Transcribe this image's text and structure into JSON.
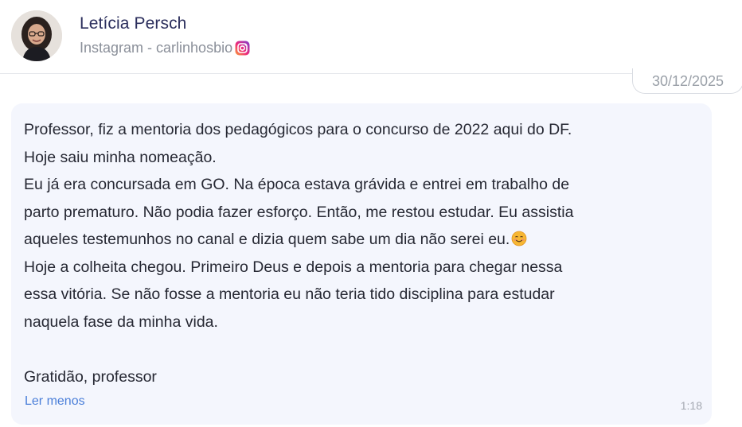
{
  "author": {
    "name": "Letícia Persch",
    "source": "Instagram - carlinhosbio",
    "avatar_icon": "profile-photo",
    "source_icon": "instagram-icon"
  },
  "date": "30/12/2025",
  "message": {
    "lines": [
      "Professor, fiz a mentoria dos pedagógicos para o concurso de 2022 aqui do DF.",
      "Hoje saiu minha nomeação.",
      "Eu já era concursada em GO. Na época estava grávida e entrei em trabalho de",
      "parto prematuro. Não podia fazer esforço. Então, me restou estudar. Eu assistia",
      "aqueles testemunhos no canal e dizia quem sabe um dia não serei eu.",
      "Hoje a colheita chegou. Primeiro Deus e depois a mentoria para chegar nessa",
      "essa vitória. Se não fosse a mentoria eu não teria tido disciplina para estudar",
      "naquela fase da minha vida.",
      "",
      "Gratidão, professor"
    ],
    "emoji": "smiling-face-emoji",
    "read_less": "Ler menos",
    "time": "1:18"
  },
  "colors": {
    "name": "#2b2e5c",
    "bubble": "#f4f6fd",
    "link": "#4b7fd9"
  }
}
